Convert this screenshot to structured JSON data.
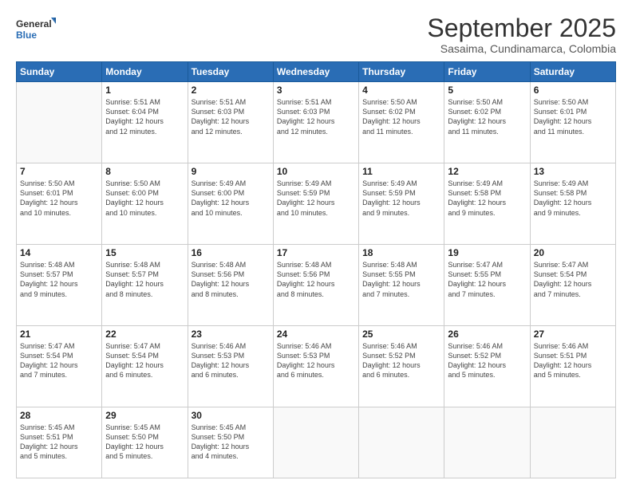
{
  "logo": {
    "line1": "General",
    "line2": "Blue"
  },
  "title": "September 2025",
  "subtitle": "Sasaima, Cundinamarca, Colombia",
  "weekdays": [
    "Sunday",
    "Monday",
    "Tuesday",
    "Wednesday",
    "Thursday",
    "Friday",
    "Saturday"
  ],
  "weeks": [
    [
      {
        "day": "",
        "info": ""
      },
      {
        "day": "1",
        "info": "Sunrise: 5:51 AM\nSunset: 6:04 PM\nDaylight: 12 hours\nand 12 minutes."
      },
      {
        "day": "2",
        "info": "Sunrise: 5:51 AM\nSunset: 6:03 PM\nDaylight: 12 hours\nand 12 minutes."
      },
      {
        "day": "3",
        "info": "Sunrise: 5:51 AM\nSunset: 6:03 PM\nDaylight: 12 hours\nand 12 minutes."
      },
      {
        "day": "4",
        "info": "Sunrise: 5:50 AM\nSunset: 6:02 PM\nDaylight: 12 hours\nand 11 minutes."
      },
      {
        "day": "5",
        "info": "Sunrise: 5:50 AM\nSunset: 6:02 PM\nDaylight: 12 hours\nand 11 minutes."
      },
      {
        "day": "6",
        "info": "Sunrise: 5:50 AM\nSunset: 6:01 PM\nDaylight: 12 hours\nand 11 minutes."
      }
    ],
    [
      {
        "day": "7",
        "info": "Sunrise: 5:50 AM\nSunset: 6:01 PM\nDaylight: 12 hours\nand 10 minutes."
      },
      {
        "day": "8",
        "info": "Sunrise: 5:50 AM\nSunset: 6:00 PM\nDaylight: 12 hours\nand 10 minutes."
      },
      {
        "day": "9",
        "info": "Sunrise: 5:49 AM\nSunset: 6:00 PM\nDaylight: 12 hours\nand 10 minutes."
      },
      {
        "day": "10",
        "info": "Sunrise: 5:49 AM\nSunset: 5:59 PM\nDaylight: 12 hours\nand 10 minutes."
      },
      {
        "day": "11",
        "info": "Sunrise: 5:49 AM\nSunset: 5:59 PM\nDaylight: 12 hours\nand 9 minutes."
      },
      {
        "day": "12",
        "info": "Sunrise: 5:49 AM\nSunset: 5:58 PM\nDaylight: 12 hours\nand 9 minutes."
      },
      {
        "day": "13",
        "info": "Sunrise: 5:49 AM\nSunset: 5:58 PM\nDaylight: 12 hours\nand 9 minutes."
      }
    ],
    [
      {
        "day": "14",
        "info": "Sunrise: 5:48 AM\nSunset: 5:57 PM\nDaylight: 12 hours\nand 9 minutes."
      },
      {
        "day": "15",
        "info": "Sunrise: 5:48 AM\nSunset: 5:57 PM\nDaylight: 12 hours\nand 8 minutes."
      },
      {
        "day": "16",
        "info": "Sunrise: 5:48 AM\nSunset: 5:56 PM\nDaylight: 12 hours\nand 8 minutes."
      },
      {
        "day": "17",
        "info": "Sunrise: 5:48 AM\nSunset: 5:56 PM\nDaylight: 12 hours\nand 8 minutes."
      },
      {
        "day": "18",
        "info": "Sunrise: 5:48 AM\nSunset: 5:55 PM\nDaylight: 12 hours\nand 7 minutes."
      },
      {
        "day": "19",
        "info": "Sunrise: 5:47 AM\nSunset: 5:55 PM\nDaylight: 12 hours\nand 7 minutes."
      },
      {
        "day": "20",
        "info": "Sunrise: 5:47 AM\nSunset: 5:54 PM\nDaylight: 12 hours\nand 7 minutes."
      }
    ],
    [
      {
        "day": "21",
        "info": "Sunrise: 5:47 AM\nSunset: 5:54 PM\nDaylight: 12 hours\nand 7 minutes."
      },
      {
        "day": "22",
        "info": "Sunrise: 5:47 AM\nSunset: 5:54 PM\nDaylight: 12 hours\nand 6 minutes."
      },
      {
        "day": "23",
        "info": "Sunrise: 5:46 AM\nSunset: 5:53 PM\nDaylight: 12 hours\nand 6 minutes."
      },
      {
        "day": "24",
        "info": "Sunrise: 5:46 AM\nSunset: 5:53 PM\nDaylight: 12 hours\nand 6 minutes."
      },
      {
        "day": "25",
        "info": "Sunrise: 5:46 AM\nSunset: 5:52 PM\nDaylight: 12 hours\nand 6 minutes."
      },
      {
        "day": "26",
        "info": "Sunrise: 5:46 AM\nSunset: 5:52 PM\nDaylight: 12 hours\nand 5 minutes."
      },
      {
        "day": "27",
        "info": "Sunrise: 5:46 AM\nSunset: 5:51 PM\nDaylight: 12 hours\nand 5 minutes."
      }
    ],
    [
      {
        "day": "28",
        "info": "Sunrise: 5:45 AM\nSunset: 5:51 PM\nDaylight: 12 hours\nand 5 minutes."
      },
      {
        "day": "29",
        "info": "Sunrise: 5:45 AM\nSunset: 5:50 PM\nDaylight: 12 hours\nand 5 minutes."
      },
      {
        "day": "30",
        "info": "Sunrise: 5:45 AM\nSunset: 5:50 PM\nDaylight: 12 hours\nand 4 minutes."
      },
      {
        "day": "",
        "info": ""
      },
      {
        "day": "",
        "info": ""
      },
      {
        "day": "",
        "info": ""
      },
      {
        "day": "",
        "info": ""
      }
    ]
  ]
}
